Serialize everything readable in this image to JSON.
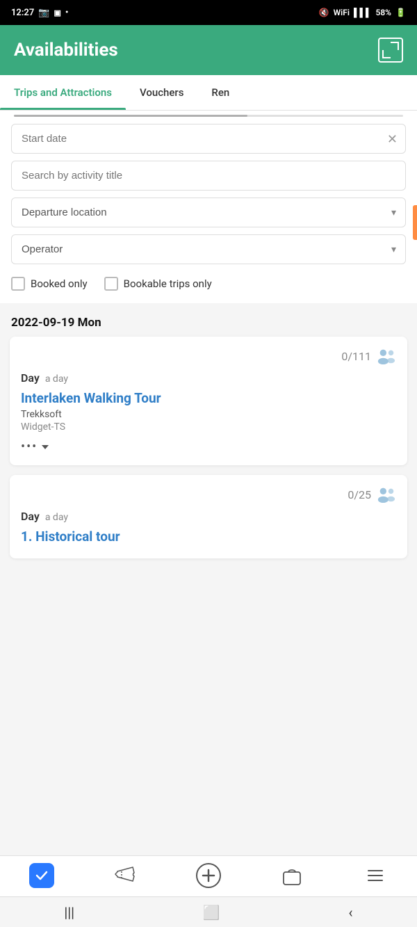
{
  "statusBar": {
    "time": "12:27",
    "batteryPercent": "58%"
  },
  "header": {
    "title": "Availabilities",
    "expandIconLabel": "expand"
  },
  "tabs": [
    {
      "id": "trips",
      "label": "Trips and Attractions",
      "active": true
    },
    {
      "id": "vouchers",
      "label": "Vouchers",
      "active": false
    },
    {
      "id": "rentals",
      "label": "Ren",
      "active": false
    }
  ],
  "filters": {
    "startDatePlaceholder": "Start date",
    "searchPlaceholder": "Search by activity title",
    "departurePlaceholder": "Departure location",
    "operatorPlaceholder": "Operator",
    "bookedOnlyLabel": "Booked only",
    "bookableOnlyLabel": "Bookable trips only"
  },
  "dateHeader": "2022-09-19 Mon",
  "cards": [
    {
      "capacity": "0/111",
      "dayLabel": "Day",
      "daySubLabel": "a day",
      "title": "Interlaken Walking Tour",
      "operator": "Trekksoft",
      "widget": "Widget-TS",
      "hasMore": true
    },
    {
      "capacity": "0/25",
      "dayLabel": "Day",
      "daySubLabel": "a day",
      "title": "1. Historical tour",
      "operator": "",
      "widget": "",
      "hasMore": false
    }
  ],
  "bottomNav": [
    {
      "id": "check",
      "icon": "check",
      "label": ""
    },
    {
      "id": "tickets",
      "icon": "ticket",
      "label": ""
    },
    {
      "id": "add",
      "icon": "plus",
      "label": ""
    },
    {
      "id": "bag",
      "icon": "bag",
      "label": ""
    },
    {
      "id": "menu",
      "icon": "menu",
      "label": ""
    }
  ],
  "androidNav": {
    "backLabel": "back",
    "homeLabel": "home",
    "recentLabel": "recent"
  }
}
